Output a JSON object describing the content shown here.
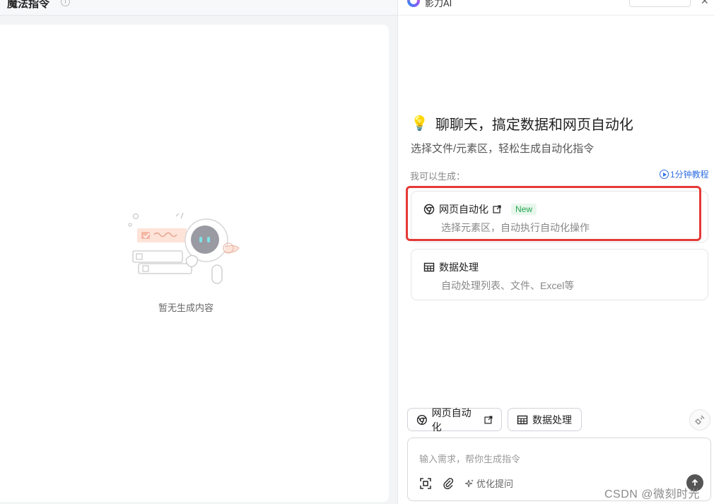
{
  "left": {
    "title": "魔法指令",
    "info_icon": "info-icon",
    "empty_text": "暂无生成内容"
  },
  "header": {
    "brand": "影刀AI"
  },
  "welcome": {
    "emoji": "💡",
    "title": "聊聊天，搞定数据和网页自动化",
    "subtitle": "选择文件/元素区，轻松生成自动化指令"
  },
  "generate": {
    "label": "我可以生成：",
    "tutorial": "1分钟教程"
  },
  "options": [
    {
      "title": "网页自动化",
      "badge": "New",
      "desc": "选择元素区，自动执行自动化操作",
      "icon": "chrome-icon"
    },
    {
      "title": "数据处理",
      "desc": "自动处理列表、文件、Excel等",
      "icon": "table-icon"
    }
  ],
  "chips": [
    {
      "label": "网页自动化",
      "icon": "chrome-icon"
    },
    {
      "label": "数据处理",
      "icon": "table-icon"
    }
  ],
  "input": {
    "placeholder": "输入需求，帮你生成指令",
    "optimize": "优化提问"
  },
  "watermark": "CSDN @微刻时光",
  "colors": {
    "accent": "#2f6fe4",
    "highlight": "#e53935",
    "new_badge": "#22a351"
  }
}
